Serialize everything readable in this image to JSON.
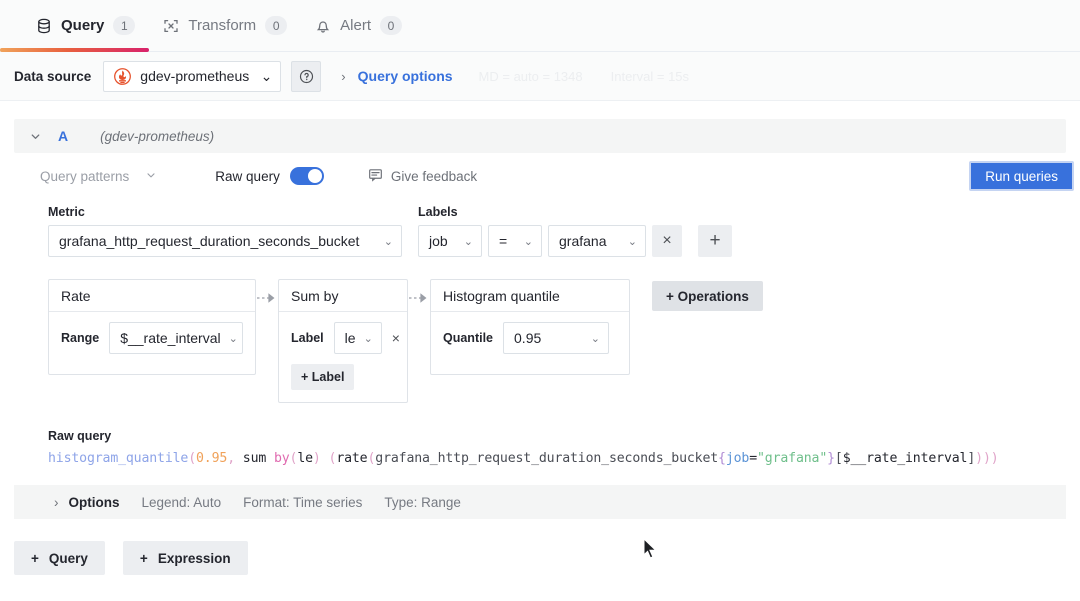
{
  "tabs": [
    {
      "label": "Query",
      "count": "1",
      "icon": "database-icon",
      "active": true
    },
    {
      "label": "Transform",
      "count": "0",
      "icon": "transform-icon",
      "active": false
    },
    {
      "label": "Alert",
      "count": "0",
      "icon": "bell-icon",
      "active": false
    }
  ],
  "datasource": {
    "label": "Data source",
    "selected": "gdev-prometheus",
    "help_icon": "help-circle-icon",
    "query_options": "Query options",
    "meta_md": "MD = auto = 1348",
    "meta_interval": "Interval = 15s"
  },
  "query": {
    "ref_id": "A",
    "ds_note": "(gdev-prometheus)",
    "query_patterns": "Query patterns",
    "raw_query_label": "Raw query",
    "raw_query_toggle_on": true,
    "give_feedback": "Give feedback",
    "run_button": "Run queries"
  },
  "metric": {
    "label": "Metric",
    "value": "grafana_http_request_duration_seconds_bucket"
  },
  "labels": {
    "label": "Labels",
    "filters": [
      {
        "key": "job",
        "op": "=",
        "value": "grafana",
        "remove": "×"
      }
    ],
    "add": "+"
  },
  "operations": [
    {
      "name": "Rate",
      "args": [
        {
          "label": "Range",
          "value": "$__rate_interval"
        }
      ]
    },
    {
      "name": "Sum by",
      "args": [
        {
          "label": "Label",
          "value": "le",
          "remove": "×"
        }
      ],
      "add_label": "+ Label"
    },
    {
      "name": "Histogram quantile",
      "args": [
        {
          "label": "Quantile",
          "value": "0.95"
        }
      ]
    }
  ],
  "operations_button": "+  Operations",
  "raw_query": {
    "title": "Raw query",
    "tokens": [
      {
        "t": "histogram_quantile",
        "c": "c-fn"
      },
      {
        "t": "(",
        "c": "c-par"
      },
      {
        "t": "0.95",
        "c": "c-num"
      },
      {
        "t": ",",
        "c": "c-par"
      },
      {
        "t": " sum ",
        "c": "c-kw"
      },
      {
        "t": "by",
        "c": "c-by"
      },
      {
        "t": "(",
        "c": "c-par"
      },
      {
        "t": "le",
        "c": "c-kw"
      },
      {
        "t": ")",
        "c": "c-par"
      },
      {
        "t": " ",
        "c": "c-kw"
      },
      {
        "t": "(",
        "c": "c-par"
      },
      {
        "t": "rate",
        "c": "c-kw"
      },
      {
        "t": "(",
        "c": "c-par"
      },
      {
        "t": "grafana_http_request_duration_seconds_bucket",
        "c": "c-met"
      },
      {
        "t": "{",
        "c": "c-brc"
      },
      {
        "t": "job",
        "c": "c-lbl"
      },
      {
        "t": "=",
        "c": "c-kw"
      },
      {
        "t": "\"grafana\"",
        "c": "c-str"
      },
      {
        "t": "}",
        "c": "c-brc"
      },
      {
        "t": "[",
        "c": "c-brk"
      },
      {
        "t": "$__rate_interval",
        "c": "c-kw"
      },
      {
        "t": "]",
        "c": "c-brk"
      },
      {
        "t": ")",
        "c": "c-par"
      },
      {
        "t": ")",
        "c": "c-par"
      },
      {
        "t": ")",
        "c": "c-par"
      }
    ],
    "full_text": "histogram_quantile(0.95, sum by(le) (rate(grafana_http_request_duration_seconds_bucket{job=\"grafana\"}[$__rate_interval])))"
  },
  "options_bar": {
    "title": "Options",
    "items": [
      "Legend: Auto",
      "Format: Time series",
      "Type: Range"
    ]
  },
  "footer": {
    "add_query": "Query",
    "add_expression": "Expression"
  },
  "colors": {
    "accent_blue": "#3871dc",
    "tab_underline_from": "#f0a25a",
    "tab_underline_to": "#d8226b",
    "prometheus_red": "#e6522c"
  }
}
